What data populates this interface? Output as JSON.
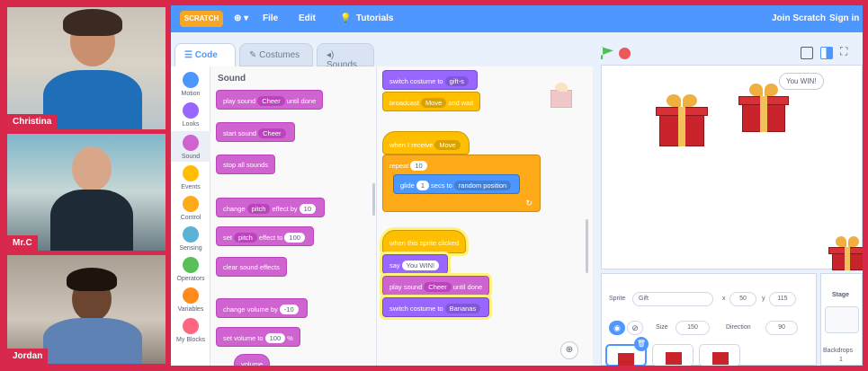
{
  "participants": [
    {
      "name": "Christina"
    },
    {
      "name": "Mr.C"
    },
    {
      "name": "Jordan"
    }
  ],
  "menubar": {
    "logo": "SCRATCH",
    "globe": "⊕ ▾",
    "file": "File",
    "edit": "Edit",
    "tutorials": "Tutorials",
    "join": "Join Scratch",
    "signin": "Sign in"
  },
  "tabs": {
    "code": "Code",
    "costumes": "Costumes",
    "sounds": "Sounds"
  },
  "categories": [
    {
      "label": "Motion",
      "color": "#4c97ff"
    },
    {
      "label": "Looks",
      "color": "#9966ff"
    },
    {
      "label": "Sound",
      "color": "#cf63cf"
    },
    {
      "label": "Events",
      "color": "#ffbf00"
    },
    {
      "label": "Control",
      "color": "#ffab19"
    },
    {
      "label": "Sensing",
      "color": "#5cb1d6"
    },
    {
      "label": "Operators",
      "color": "#59c059"
    },
    {
      "label": "Variables",
      "color": "#ff8c1a"
    },
    {
      "label": "My Blocks",
      "color": "#ff6680"
    }
  ],
  "palette": {
    "heading": "Sound",
    "play_sound": "play sound",
    "play_sound_arg": "Cheer",
    "until_done": "until done",
    "start_sound": "start sound",
    "start_sound_arg": "Cheer",
    "stop_all": "stop all sounds",
    "change_pitch": "change",
    "pitch_arg": "pitch",
    "effect_by": "effect by",
    "effect_by_val": "10",
    "set_pitch": "set",
    "set_pitch_arg": "pitch",
    "effect_to": "effect to",
    "effect_to_val": "100",
    "clear_effects": "clear sound effects",
    "change_volume": "change volume by",
    "change_volume_val": "-10",
    "set_volume": "set volume to",
    "set_volume_val": "100",
    "set_volume_unit": "%",
    "volume": "volume"
  },
  "script": {
    "switch_costume": "switch costume to",
    "switch_costume_arg": "gift-s",
    "broadcast": "broadcast",
    "broadcast_arg": "Move",
    "and_wait": "and wait",
    "when_receive": "when I receive",
    "when_receive_arg": "Move",
    "repeat": "repeat",
    "repeat_val": "10",
    "glide": "glide",
    "glide_val": "1",
    "secs_to": "secs to",
    "glide_target": "random position",
    "when_clicked": "when this sprite clicked",
    "say": "say",
    "say_val": "You WIN!",
    "play_sound": "play sound",
    "play_sound_arg": "Cheer",
    "until_done": "until done",
    "switch_costume2": "switch costume to",
    "switch_costume2_arg": "Bananas"
  },
  "stage": {
    "bubble": "You WIN!"
  },
  "sprite_info": {
    "sprite_label": "Sprite",
    "sprite_name": "Gift",
    "x_label": "x",
    "x": "50",
    "y_label": "y",
    "y": "115",
    "show_label": "Show",
    "size_label": "Size",
    "size": "150",
    "direction_label": "Direction",
    "direction": "90"
  },
  "stage_pane": {
    "label": "Stage",
    "backdrops_label": "Backdrops",
    "backdrops_count": "1"
  }
}
